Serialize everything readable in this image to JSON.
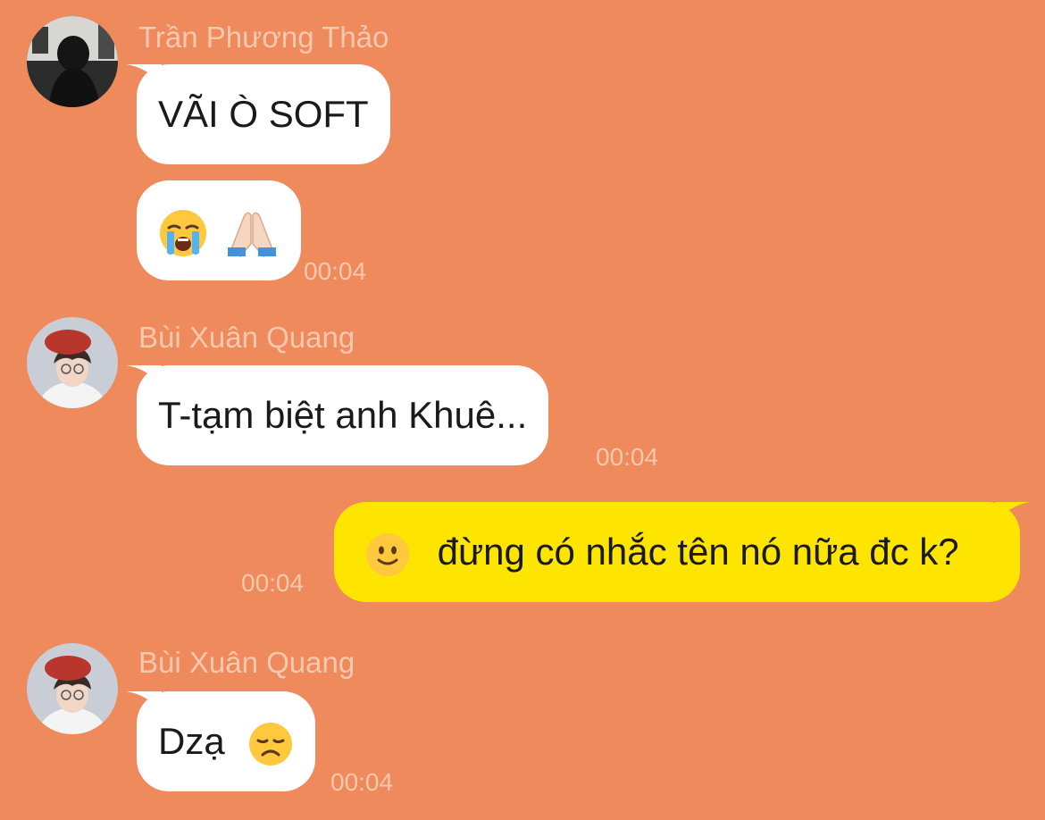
{
  "colors": {
    "background": "#EE8A5B",
    "incoming_bubble": "#FFFFFF",
    "outgoing_bubble": "#FEE500",
    "meta_text": "#F9C8AE"
  },
  "messages": [
    {
      "sender": "Trần Phương Thảo",
      "bubbles": [
        {
          "text": "VÃI Ò SOFT"
        },
        {
          "emoji": [
            "loudly-crying-face",
            "folded-hands"
          ],
          "time": "00:04"
        }
      ]
    },
    {
      "sender": "Bùi Xuân Quang",
      "bubbles": [
        {
          "text": "T-tạm biệt anh Khuê...",
          "time": "00:04"
        }
      ]
    },
    {
      "outgoing": true,
      "bubbles": [
        {
          "emoji": [
            "slightly-smiling-face"
          ],
          "text": "đừng có nhắc tên nó nữa đc k?",
          "time": "00:04"
        }
      ]
    },
    {
      "sender": "Bùi Xuân Quang",
      "bubbles": [
        {
          "text": "Dzạ",
          "emoji": [
            "disappointed-face"
          ],
          "time": "00:04"
        }
      ]
    }
  ]
}
